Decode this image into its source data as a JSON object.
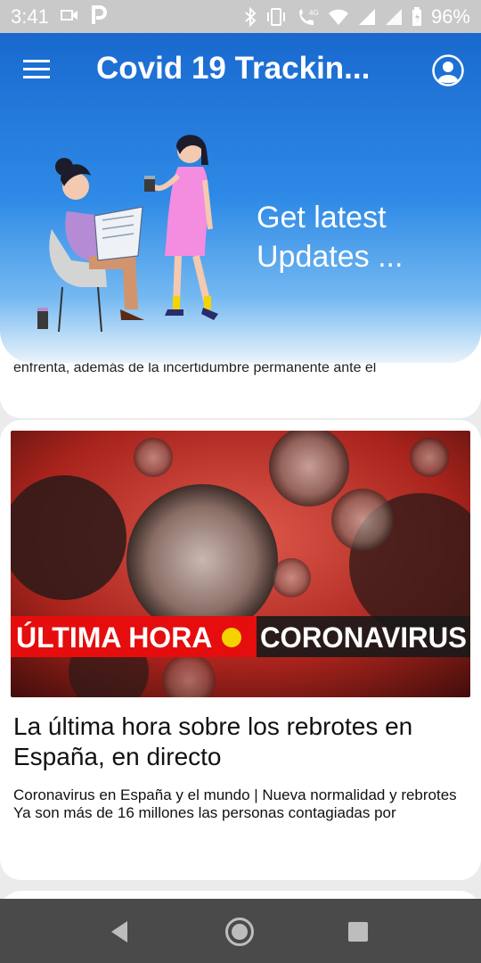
{
  "status_bar": {
    "time": "3:41",
    "battery_percent": "96%",
    "network_label": "4G",
    "icons": [
      "video-camera-icon",
      "parking-icon",
      "bluetooth-icon",
      "vibrate-icon",
      "wifi-call-icon",
      "wifi-icon",
      "signal-icon",
      "battery-icon"
    ]
  },
  "header": {
    "title": "Covid 19 Trackin...",
    "tagline": "Get latest\nUpdates ...",
    "colors": {
      "top": "#1969cf",
      "bottom": "#e9f3fb"
    }
  },
  "feed": {
    "cards": [
      {
        "snippet": "enfrenta, además de la incertidumbre permanente ante el"
      },
      {
        "image_banner_left": "ÚLTIMA HORA",
        "image_banner_right": "CORONAVIRUS",
        "headline": "La última hora sobre los rebrotes en España, en directo",
        "subtitle": "Coronavirus en España y el mundo | Nueva normalidad y rebrotes",
        "snippet": "Ya son más de 16 millones las personas contagiadas por"
      }
    ]
  },
  "nav_bar": {
    "buttons": [
      "back",
      "home",
      "recents"
    ]
  }
}
